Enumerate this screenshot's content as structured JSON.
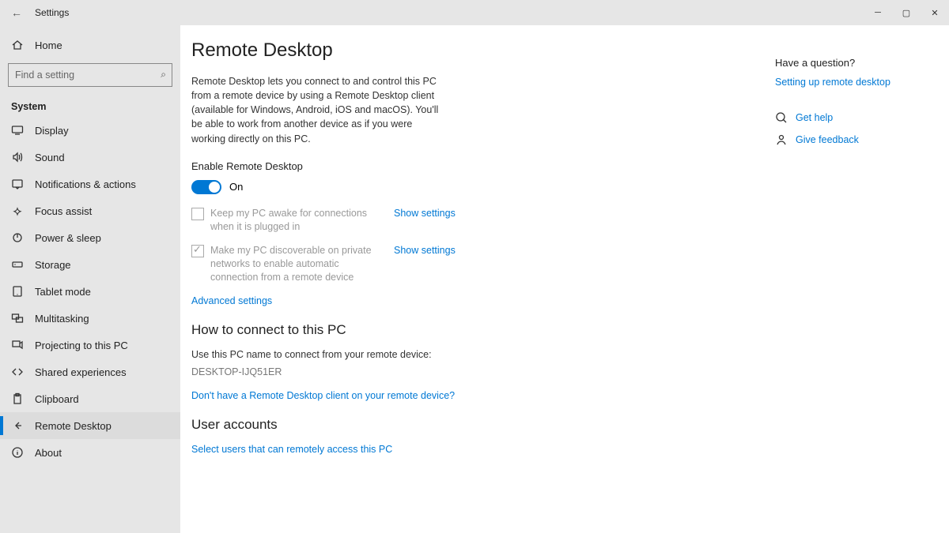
{
  "titlebar": {
    "title": "Settings"
  },
  "sidebar": {
    "home": "Home",
    "search_placeholder": "Find a setting",
    "section": "System",
    "items": [
      {
        "label": "Display"
      },
      {
        "label": "Sound"
      },
      {
        "label": "Notifications & actions"
      },
      {
        "label": "Focus assist"
      },
      {
        "label": "Power & sleep"
      },
      {
        "label": "Storage"
      },
      {
        "label": "Tablet mode"
      },
      {
        "label": "Multitasking"
      },
      {
        "label": "Projecting to this PC"
      },
      {
        "label": "Shared experiences"
      },
      {
        "label": "Clipboard"
      },
      {
        "label": "Remote Desktop"
      },
      {
        "label": "About"
      }
    ]
  },
  "page": {
    "title": "Remote Desktop",
    "desc": "Remote Desktop lets you connect to and control this PC from a remote device by using a Remote Desktop client (available for Windows, Android, iOS and macOS). You'll be able to work from another device as if you were working directly on this PC.",
    "enable_label": "Enable Remote Desktop",
    "toggle_state": "On",
    "check1": "Keep my PC awake for connections when it is plugged in",
    "check2": "Make my PC discoverable on private networks to enable automatic connection from a remote device",
    "show_settings": "Show settings",
    "advanced": "Advanced settings",
    "howto_title": "How to connect to this PC",
    "howto_text": "Use this PC name to connect from your remote device:",
    "pcname": "DESKTOP-IJQ51ER",
    "noclient": "Don't have a Remote Desktop client on your remote device?",
    "useracc_title": "User accounts",
    "selectusers": "Select users that can remotely access this PC"
  },
  "right": {
    "question": "Have a question?",
    "setup": "Setting up remote desktop",
    "gethelp": "Get help",
    "feedback": "Give feedback"
  }
}
